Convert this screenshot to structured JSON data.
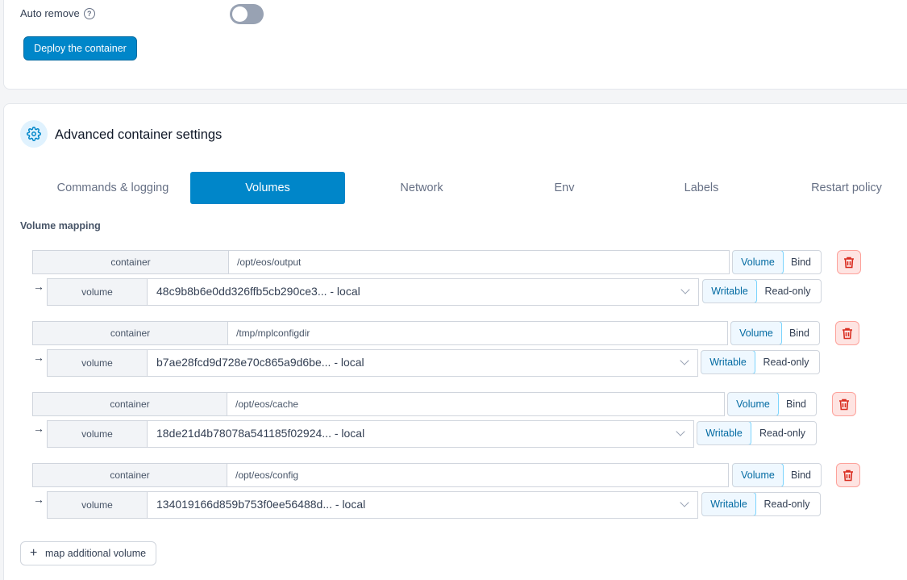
{
  "top": {
    "auto_remove_label": "Auto remove",
    "help_glyph": "?",
    "deploy_label": "Deploy the container"
  },
  "advanced": {
    "title": "Advanced container settings",
    "tabs": [
      "Commands & logging",
      "Volumes",
      "Network",
      "Env",
      "Labels",
      "Restart policy"
    ],
    "active_tab": "Volumes",
    "volume_mapping_label": "Volume mapping"
  },
  "volumes": [
    {
      "container_label": "container",
      "path": "/opt/eos/output",
      "type_options": [
        "Volume",
        "Bind"
      ],
      "type": "Volume",
      "volume_label": "volume",
      "volume_value": "48c9b8b6e0dd326ffb5cb290ce3... - local",
      "mode_options": [
        "Writable",
        "Read-only"
      ],
      "mode": "Writable"
    },
    {
      "container_label": "container",
      "path": "/tmp/mplconfigdir",
      "type_options": [
        "Volume",
        "Bind"
      ],
      "type": "Volume",
      "volume_label": "volume",
      "volume_value": "b7ae28fcd9d728e70c865a9d6be... - local",
      "mode_options": [
        "Writable",
        "Read-only"
      ],
      "mode": "Writable"
    },
    {
      "container_label": "container",
      "path": "/opt/eos/cache",
      "type_options": [
        "Volume",
        "Bind"
      ],
      "type": "Volume",
      "volume_label": "volume",
      "volume_value": "18de21d4b78078a541185f02924... - local",
      "mode_options": [
        "Writable",
        "Read-only"
      ],
      "mode": "Writable"
    },
    {
      "container_label": "container",
      "path": "/opt/eos/config",
      "type_options": [
        "Volume",
        "Bind"
      ],
      "type": "Volume",
      "volume_label": "volume",
      "volume_value": "134019166d859b753f0ee56488d... - local",
      "mode_options": [
        "Writable",
        "Read-only"
      ],
      "mode": "Writable"
    }
  ],
  "map_additional_label": "map additional volume",
  "arrow_glyph": "→",
  "plus_glyph": "+",
  "colors": {
    "accent": "#0086c9",
    "danger": "#d92d20",
    "toggle_off": "#98a2b3"
  },
  "icons": [
    "help-circle-icon",
    "gear-icon",
    "arrow-right-icon",
    "trash-icon",
    "chevron-down-icon",
    "plus-icon"
  ]
}
